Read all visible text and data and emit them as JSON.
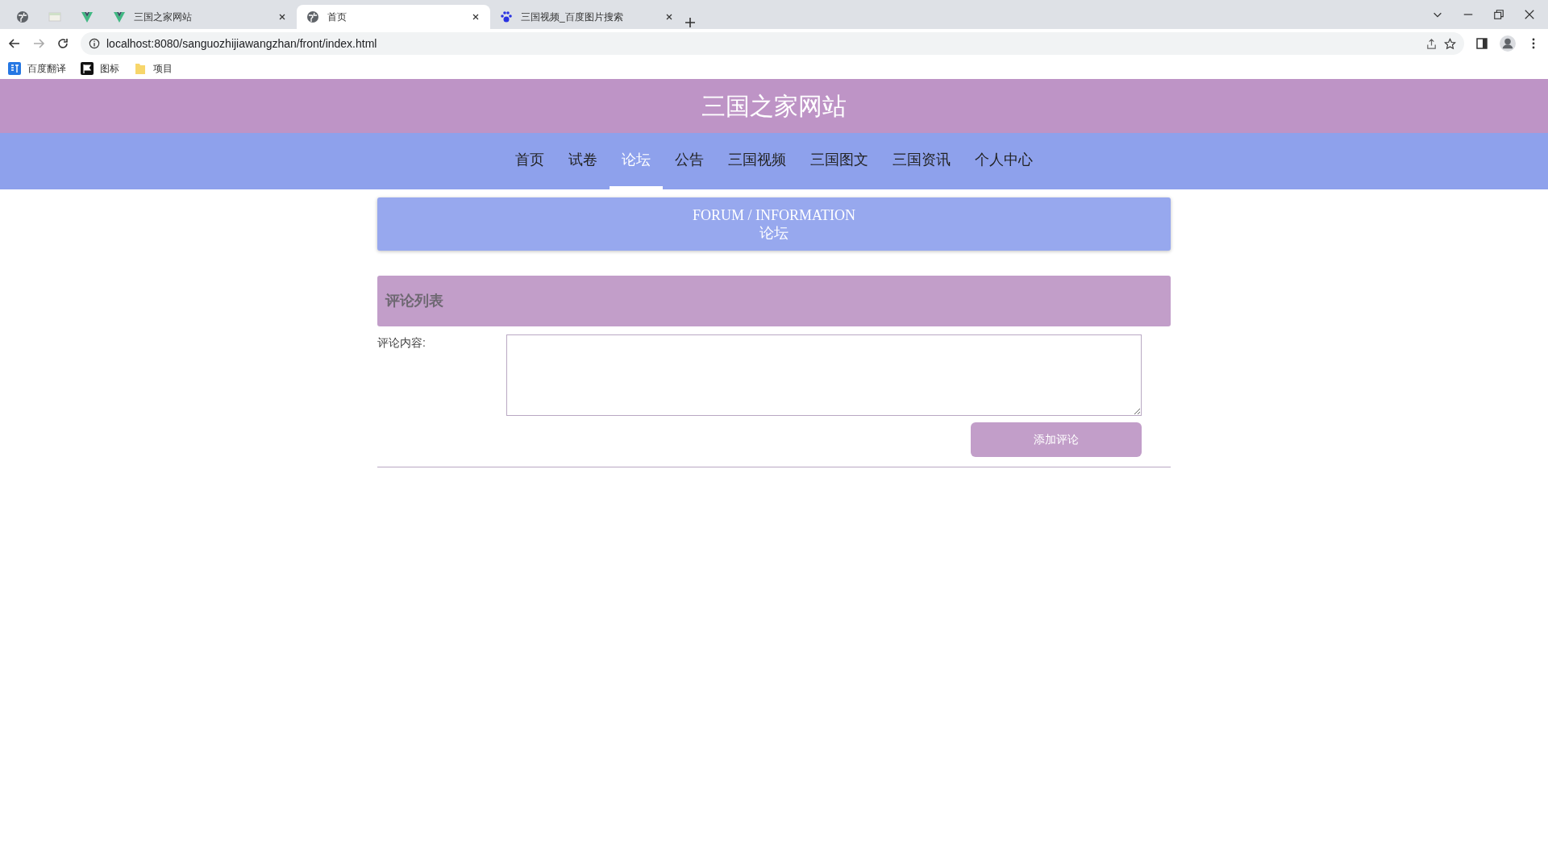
{
  "browser": {
    "tabs": [
      {
        "kind": "pinned",
        "selected": false
      },
      {
        "kind": "pinned",
        "selected": false
      },
      {
        "kind": "pinned",
        "selected": false
      },
      {
        "kind": "normal",
        "title": "三国之家网站",
        "selected": false
      },
      {
        "kind": "normal",
        "title": "首页",
        "selected": true
      },
      {
        "kind": "normal",
        "title": "三国视频_百度图片搜索",
        "selected": false
      }
    ],
    "address": "localhost:8080/sanguozhijiawangzhan/front/index.html",
    "bookmarks": [
      {
        "label": "百度翻译"
      },
      {
        "label": "图标"
      },
      {
        "label": "项目"
      }
    ]
  },
  "site": {
    "title": "三国之家网站",
    "nav": [
      {
        "label": "首页",
        "selected": false
      },
      {
        "label": "试卷",
        "selected": false
      },
      {
        "label": "论坛",
        "selected": true
      },
      {
        "label": "公告",
        "selected": false
      },
      {
        "label": "三国视频",
        "selected": false
      },
      {
        "label": "三国图文",
        "selected": false
      },
      {
        "label": "三国资讯",
        "selected": false
      },
      {
        "label": "个人中心",
        "selected": false
      }
    ]
  },
  "banner": {
    "subtitle": "FORUM / INFORMATION",
    "title": "论坛"
  },
  "comments": {
    "heading": "评论列表",
    "field_label": "评论内容:",
    "button": "添加评论"
  }
}
